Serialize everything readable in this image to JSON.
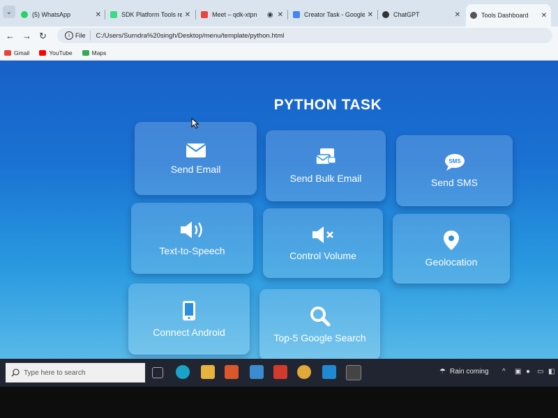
{
  "browser": {
    "tabs": [
      {
        "title": "(5) WhatsApp",
        "icon": "whatsapp-icon",
        "color": "#25d366"
      },
      {
        "title": "SDK Platform Tools re",
        "icon": "android-icon",
        "color": "#3ddc84"
      },
      {
        "title": "Meet – qdk-xtpn",
        "icon": "meet-icon",
        "color": "#e8453c"
      },
      {
        "title": "Creator Task - Google",
        "icon": "docs-icon",
        "color": "#4285f4"
      },
      {
        "title": "ChatGPT",
        "icon": "chatgpt-icon",
        "color": "#333333"
      },
      {
        "title": "Tools Dashboard",
        "icon": "globe-icon",
        "color": "#555555"
      }
    ],
    "active_tab_index": 5,
    "address": {
      "scheme_chip": "File",
      "url": "C:/Users/Surndra%20singh/Desktop/menu/template/python.html"
    },
    "bookmarks": [
      {
        "label": "Gmail",
        "icon": "gmail-icon",
        "color": "#ea4335"
      },
      {
        "label": "YouTube",
        "icon": "youtube-icon",
        "color": "#ff0000"
      },
      {
        "label": "Maps",
        "icon": "maps-icon",
        "color": "#34a853"
      }
    ]
  },
  "page": {
    "title": "PYTHON TASK",
    "cards": [
      {
        "label": "Send Email",
        "icon": "envelope-icon"
      },
      {
        "label": "Send Bulk Email",
        "icon": "bulk-email-icon"
      },
      {
        "label": "Send SMS",
        "icon": "sms-icon",
        "icon_text": "SMS"
      },
      {
        "label": "Text-to-Speech",
        "icon": "speaker-icon"
      },
      {
        "label": "Control Volume",
        "icon": "mute-icon"
      },
      {
        "label": "Geolocation",
        "icon": "map-pin-icon"
      },
      {
        "label": "Connect Android",
        "icon": "phone-icon"
      },
      {
        "label": "Top-5 Google Search",
        "icon": "search-icon"
      }
    ],
    "accent": "#1a73d3"
  },
  "taskbar": {
    "search_placeholder": "Type here to search",
    "weather": "Rain coming",
    "apps": [
      "task-view-icon",
      "edge-icon",
      "file-explorer-icon",
      "store-icon",
      "app-icon",
      "office-icon",
      "chrome-icon",
      "vscode-icon",
      "terminal-icon"
    ]
  }
}
